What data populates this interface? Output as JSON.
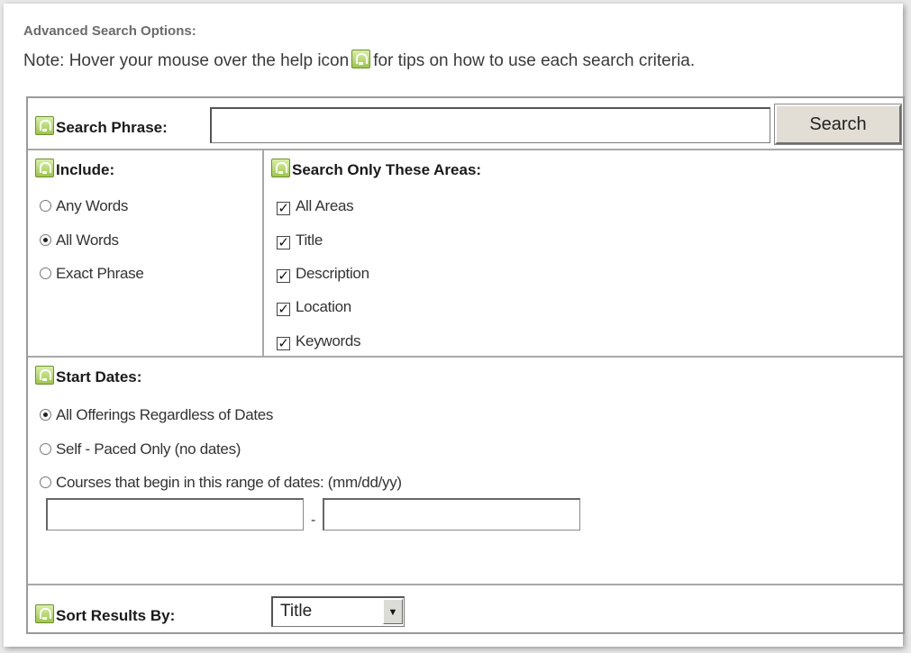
{
  "heading": "Advanced Search Options:",
  "note": {
    "before": "Note: Hover your mouse over the help icon",
    "after": "for tips on how to use each search criteria."
  },
  "search": {
    "label": "Search Phrase:",
    "value": "",
    "button_label": "Search"
  },
  "include": {
    "label": "Include:",
    "options": [
      "Any Words",
      "All Words",
      "Exact Phrase"
    ],
    "selected": "All Words"
  },
  "areas": {
    "label": "Search Only These Areas:",
    "items": [
      {
        "label": "All Areas",
        "checked": true
      },
      {
        "label": "Title",
        "checked": true
      },
      {
        "label": "Description",
        "checked": true
      },
      {
        "label": "Location",
        "checked": true
      },
      {
        "label": "Keywords",
        "checked": true
      }
    ]
  },
  "start_dates": {
    "label": "Start Dates:",
    "options": [
      "All Offerings Regardless of Dates",
      "Self - Paced Only (no dates)",
      "Courses that begin in this range of dates: (mm/dd/yy)"
    ],
    "selected": "All Offerings Regardless of Dates",
    "from_value": "",
    "to_value": "",
    "separator": "-"
  },
  "sort": {
    "label": "Sort Results By:",
    "selected": "Title"
  },
  "icons": {
    "help": "help-icon",
    "radio": "radio-button",
    "checkbox": "checkbox",
    "dropdown": "dropdown-arrow"
  },
  "colors": {
    "help_icon": "#9cc74a",
    "border": "#a8a8a8",
    "button_bg": "#e2ded6"
  }
}
